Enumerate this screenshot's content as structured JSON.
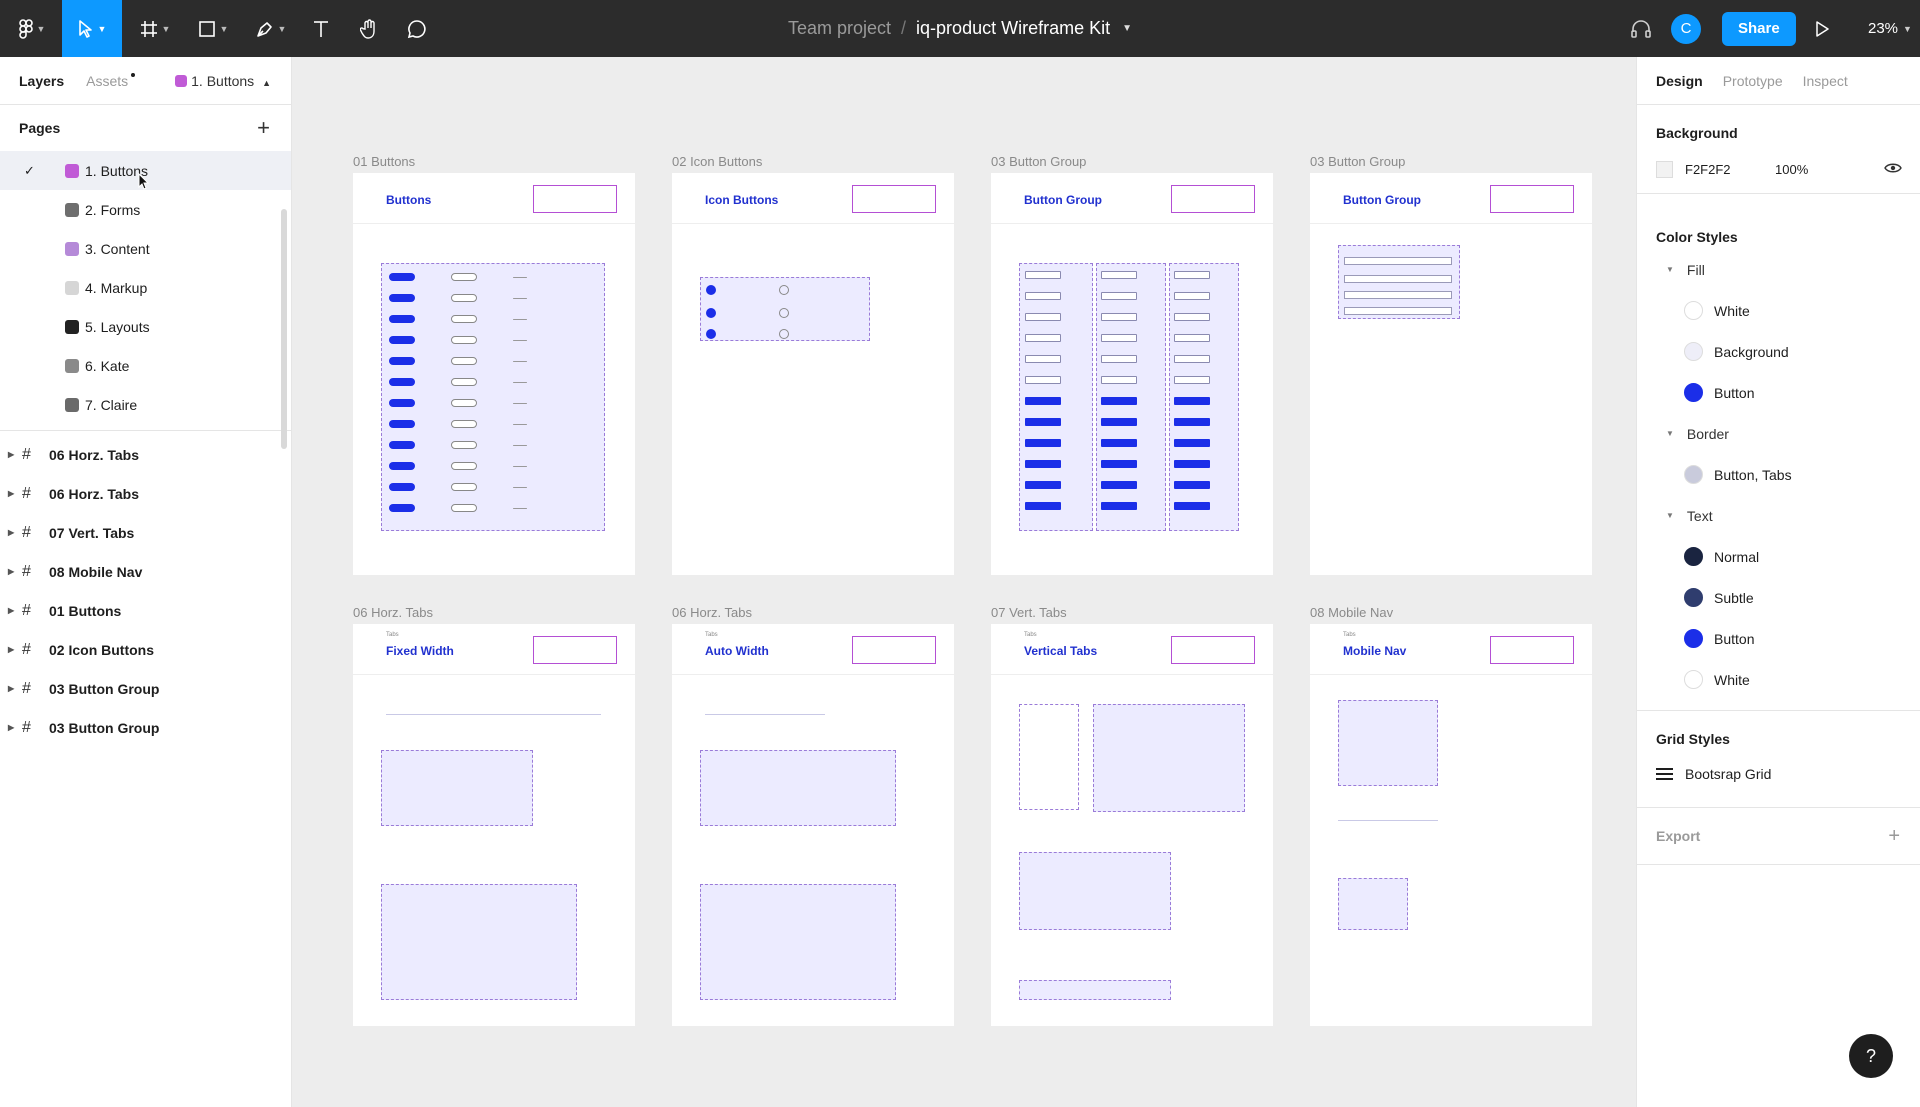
{
  "toolbar": {
    "team": "Team project",
    "separator": "/",
    "file": "iq-product Wireframe Kit",
    "avatar": "C",
    "share": "Share",
    "zoom": "23%"
  },
  "left": {
    "tabs": {
      "layers": "Layers",
      "assets": "Assets",
      "page_selector": "1. Buttons"
    },
    "pages_title": "Pages",
    "pages": [
      {
        "label": "1.  Buttons",
        "color": "#c05bd6",
        "active": true
      },
      {
        "label": "2. Forms",
        "color": "#6e6e6e"
      },
      {
        "label": "3.  Content",
        "color": "#b58ad8"
      },
      {
        "label": "4. Markup",
        "color": "#d6d6d6"
      },
      {
        "label": "5. Layouts",
        "color": "#222222"
      },
      {
        "label": "6.  Kate",
        "color": "#8a8a8a"
      },
      {
        "label": "7.  Claire",
        "color": "#6a6a6a"
      }
    ],
    "layers": [
      "06 Horz. Tabs",
      "06 Horz. Tabs",
      "07 Vert. Tabs",
      "08 Mobile Nav",
      "01 Buttons",
      "02 Icon Buttons",
      "03 Button Group",
      "03 Button Group"
    ]
  },
  "canvas": {
    "frames": [
      {
        "label": "01 Buttons",
        "title": "Buttons"
      },
      {
        "label": "02 Icon Buttons",
        "title": "Icon Buttons"
      },
      {
        "label": "03 Button Group",
        "title": "Button Group"
      },
      {
        "label": "03 Button Group",
        "title": "Button Group"
      },
      {
        "label": "06 Horz. Tabs",
        "title": "Fixed Width",
        "sub": "Tabs"
      },
      {
        "label": "06 Horz. Tabs",
        "title": "Auto Width",
        "sub": "Tabs"
      },
      {
        "label": "07 Vert. Tabs",
        "title": "Vertical Tabs",
        "sub": "Tabs"
      },
      {
        "label": "08 Mobile Nav",
        "title": "Mobile Nav",
        "sub": "Tabs"
      }
    ]
  },
  "right": {
    "tabs": {
      "design": "Design",
      "prototype": "Prototype",
      "inspect": "Inspect"
    },
    "background": {
      "title": "Background",
      "hex": "F2F2F2",
      "opacity": "100%",
      "color": "#f2f2f2"
    },
    "color_styles": {
      "title": "Color Styles",
      "groups": [
        {
          "name": "Fill",
          "items": [
            {
              "name": "White",
              "color": "#ffffff"
            },
            {
              "name": "Background",
              "color": "#eeeef8"
            },
            {
              "name": "Button",
              "color": "#1b2ee8"
            }
          ]
        },
        {
          "name": "Border",
          "items": [
            {
              "name": "Button, Tabs",
              "color": "#c9cbdc"
            }
          ]
        },
        {
          "name": "Text",
          "items": [
            {
              "name": "Normal",
              "color": "#1a2440"
            },
            {
              "name": "Subtle",
              "color": "#2f3d6e"
            },
            {
              "name": "Button",
              "color": "#1b2ee8"
            },
            {
              "name": "White",
              "color": "#ffffff"
            }
          ]
        }
      ]
    },
    "grid_styles": {
      "title": "Grid Styles",
      "item": "Bootsrap Grid"
    },
    "export": "Export"
  },
  "help": "?"
}
